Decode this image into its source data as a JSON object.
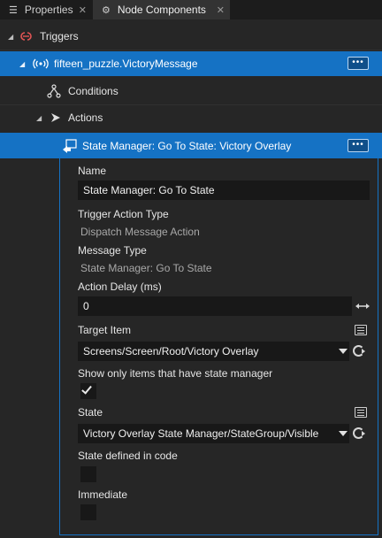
{
  "tabs": [
    {
      "label": "Properties",
      "icon": "list-icon",
      "close": "✕"
    },
    {
      "label": "Node Components",
      "icon": "component-icon",
      "close": "✕"
    }
  ],
  "tree": {
    "triggers": {
      "label": "Triggers",
      "icon": "trigger-icon"
    },
    "message": {
      "label": "fifteen_puzzle.VictoryMessage",
      "icon": "broadcast-icon",
      "more": "•••"
    },
    "conditions": {
      "label": "Conditions",
      "icon": "conditions-icon"
    },
    "actions": {
      "label": "Actions",
      "icon": "actions-icon"
    },
    "action_item": {
      "label": "State Manager: Go To State: Victory Overlay",
      "icon": "action-item-icon",
      "more": "•••"
    }
  },
  "props": {
    "name_label": "Name",
    "name_value": "State Manager: Go To State",
    "trigger_type_label": "Trigger Action Type",
    "trigger_type_value": "Dispatch Message Action",
    "message_type_label": "Message Type",
    "message_type_value": "State Manager: Go To State",
    "delay_label": "Action Delay (ms)",
    "delay_value": "0",
    "target_label": "Target Item",
    "target_value": "Screens/Screen/Root/Victory Overlay",
    "show_only_label": "Show only items that have state manager",
    "show_only_checked": true,
    "state_label": "State",
    "state_value": "Victory Overlay State Manager/StateGroup/Visible",
    "defined_in_code_label": "State defined in code",
    "defined_in_code_checked": false,
    "immediate_label": "Immediate",
    "immediate_checked": false
  },
  "colors": {
    "selection": "#1572c4",
    "background": "#262626",
    "field": "#181818"
  }
}
